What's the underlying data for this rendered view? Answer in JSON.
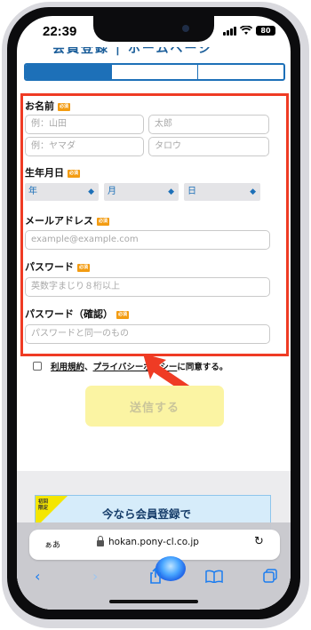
{
  "status": {
    "time": "22:39",
    "battery": "80"
  },
  "header": {
    "title": "会員登録 | ホームページ"
  },
  "form": {
    "name_label": "お名前",
    "required_badge": "必須",
    "last_name_placeholder": "例：山田",
    "first_name_placeholder": "太郎",
    "last_kana_placeholder": "例：ヤマダ",
    "first_kana_placeholder": "タロウ",
    "dob_label": "生年月日",
    "year_label": "年",
    "month_label": "月",
    "day_label": "日",
    "email_label": "メールアドレス",
    "email_placeholder": "example@example.com",
    "password_label": "パスワード",
    "password_placeholder": "英数字まじり８桁以上",
    "password_confirm_label": "パスワード（確認）",
    "password_confirm_placeholder": "パスワードと同一のもの"
  },
  "agreement": {
    "terms": "利用規約",
    "separator": "、",
    "privacy": "プライバシーポリシー",
    "suffix": "に同意する。"
  },
  "submit": {
    "label": "送信する"
  },
  "promo": {
    "badge": "初回限定",
    "text": "今なら会員登録で"
  },
  "browser": {
    "aa": "ぁあ",
    "url": "hokan.pony-cl.co.jp"
  },
  "icons": {
    "back": "chevron-left-icon",
    "forward": "chevron-right-icon",
    "share": "share-icon",
    "bookmarks": "book-icon",
    "tabs": "tabs-icon",
    "reload": "reload-icon"
  },
  "colors": {
    "accent": "#1d70b8",
    "highlight": "#ef3b24",
    "required": "#f39c12",
    "submit_bg": "#fbf4a3"
  }
}
